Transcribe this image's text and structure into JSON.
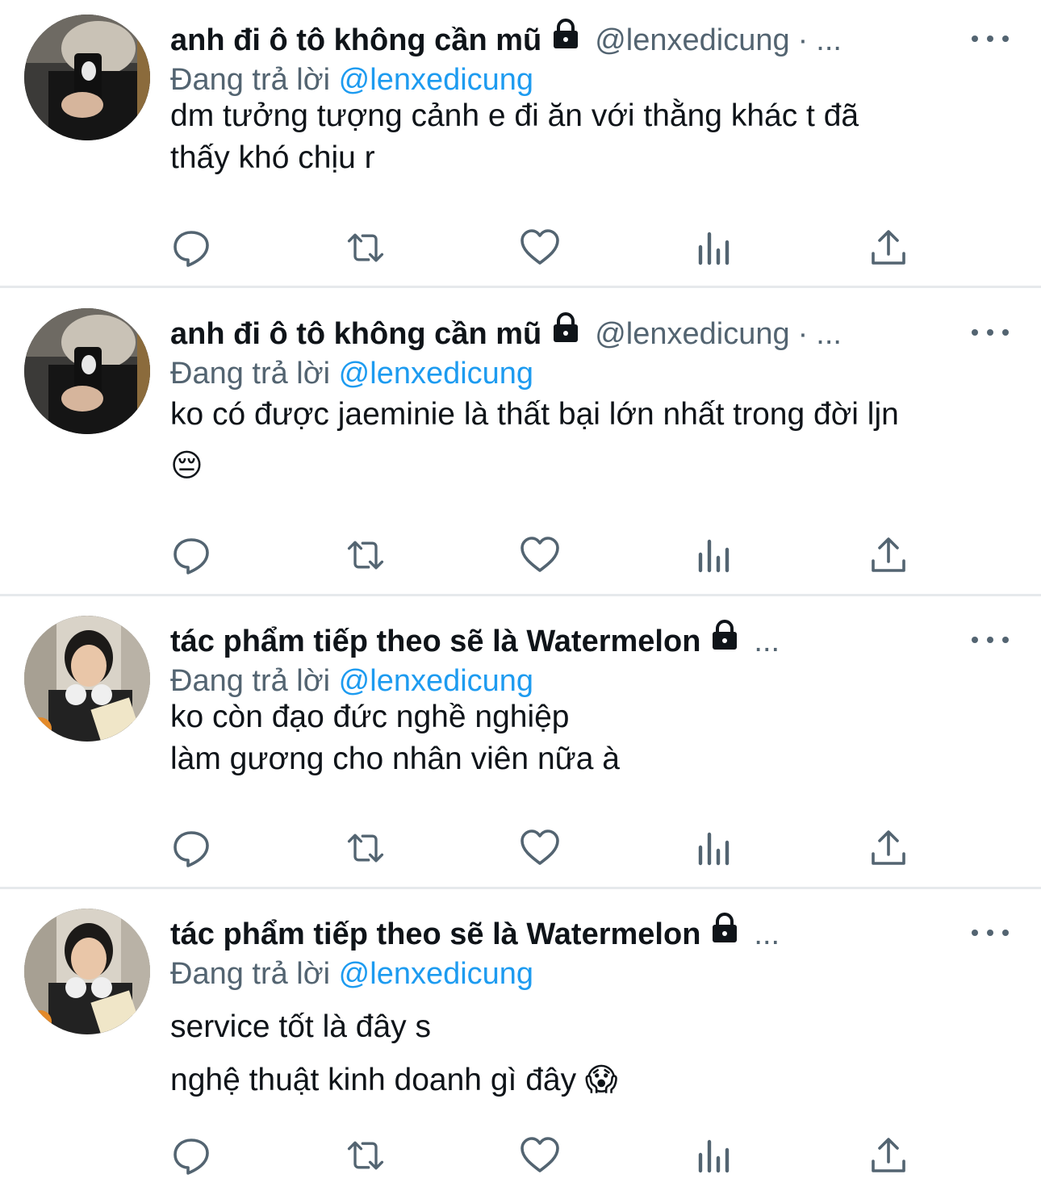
{
  "tweets": [
    {
      "name": "anh đi ô tô không cần mũ",
      "handle": "@lenxedicung",
      "separator": "·",
      "ellipsis": "...",
      "reply_prefix": "Đang trả lời",
      "reply_to": "@lenxedicung",
      "lines": [
        "dm tưởng tượng cảnh e đi ăn với thằng khác t đã",
        "thấy khó chịu r"
      ],
      "emoji": ""
    },
    {
      "name": "anh đi ô tô không cần mũ",
      "handle": "@lenxedicung",
      "separator": "·",
      "ellipsis": "...",
      "reply_prefix": "Đang trả lời",
      "reply_to": "@lenxedicung",
      "lines": [
        "ko có được jaeminie là thất bại lớn nhất trong đời ljn",
        ""
      ],
      "emoji": "😔"
    },
    {
      "name": "tác phẩm tiếp theo sẽ là Watermelon",
      "handle": "",
      "separator": "",
      "ellipsis": "...",
      "reply_prefix": "Đang trả lời",
      "reply_to": "@lenxedicung",
      "lines": [
        "ko còn đạo đức nghề nghiệp",
        "làm gương cho nhân viên nữa à"
      ],
      "emoji": ""
    },
    {
      "name": "tác phẩm tiếp theo sẽ là Watermelon",
      "handle": "",
      "separator": "",
      "ellipsis": "...",
      "reply_prefix": "Đang trả lời",
      "reply_to": "@lenxedicung",
      "lines": [
        "service tốt là đây s",
        "nghệ thuật kinh doanh gì đây"
      ],
      "emoji": "😱"
    }
  ],
  "colors": {
    "text": "#0f1419",
    "secondary": "#536471",
    "accent": "#1d9bf0",
    "divider": "#e6e9ec"
  },
  "icons": [
    "lock-icon",
    "more-icon",
    "reply-icon",
    "retweet-icon",
    "like-icon",
    "analytics-icon",
    "share-icon"
  ]
}
